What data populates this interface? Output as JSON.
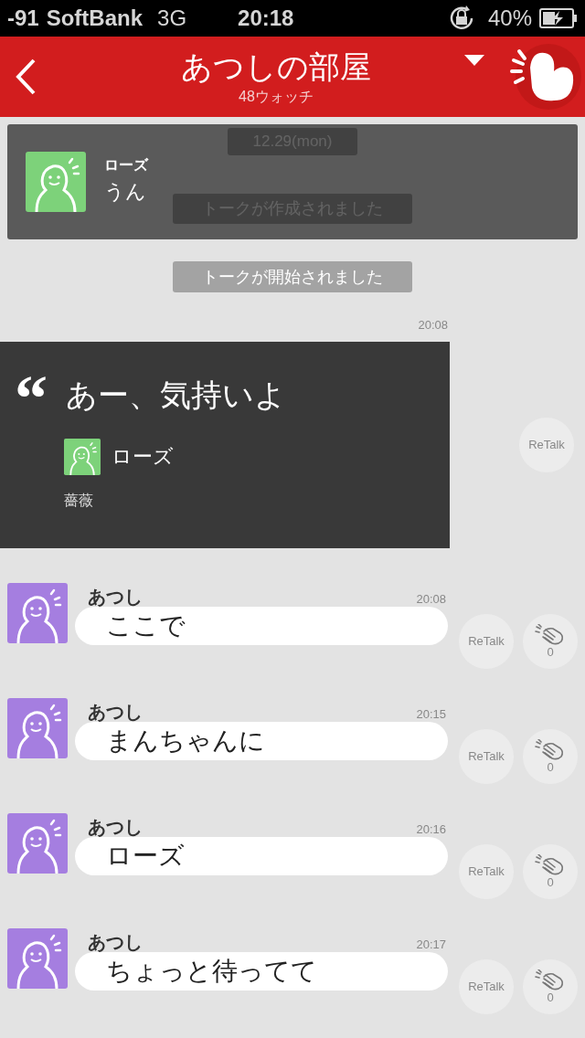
{
  "status_bar": {
    "signal": "-91",
    "carrier": "SoftBank",
    "network": "3G",
    "time": "20:18",
    "battery": "40%"
  },
  "header": {
    "title": "あつしの部屋",
    "subtitle": "48ウォッチ"
  },
  "pinned": {
    "name": "ローズ",
    "text": "うん"
  },
  "system_messages": [
    "12.29(mon)",
    "トークが作成されました",
    "トークが開始されました"
  ],
  "quote": {
    "time": "20:08",
    "mark": "“",
    "text": "あー、気持いよ",
    "author": "ローズ",
    "caption": "薔薇",
    "retalk": "ReTalk"
  },
  "messages": [
    {
      "name": "あつし",
      "time": "20:08",
      "text": "ここで",
      "retalk": "ReTalk",
      "claps": "0"
    },
    {
      "name": "あつし",
      "time": "20:15",
      "text": "まんちゃんに",
      "retalk": "ReTalk",
      "claps": "0"
    },
    {
      "name": "あつし",
      "time": "20:16",
      "text": "ローズ",
      "retalk": "ReTalk",
      "claps": "0"
    },
    {
      "name": "あつし",
      "time": "20:17",
      "text": "ちょっと待ってて",
      "retalk": "ReTalk",
      "claps": "0"
    }
  ]
}
